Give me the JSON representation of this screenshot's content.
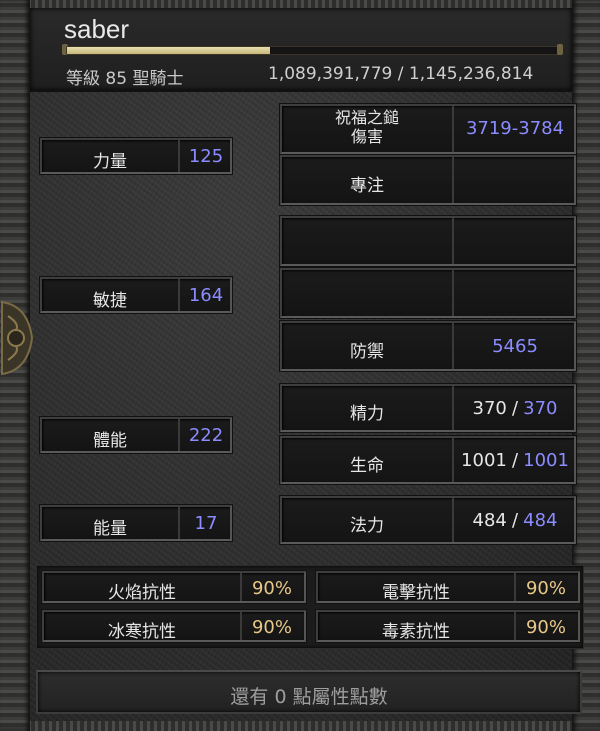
{
  "character": {
    "name": "saber",
    "level_class": "等級 85 聖騎士",
    "xp_text": "1,089,391,779 / 1,145,236,814",
    "xp_bar_fraction": 0.41
  },
  "attributes": [
    {
      "label": "力量",
      "value": "125"
    },
    {
      "label": "敏捷",
      "value": "164"
    },
    {
      "label": "體能",
      "value": "222"
    },
    {
      "label": "能量",
      "value": "17"
    }
  ],
  "stats": {
    "skill": {
      "label_line1": "祝福之鎚",
      "label_line2": "傷害",
      "value": "3719-3784"
    },
    "focus": {
      "label": "專注",
      "value": ""
    },
    "defense": {
      "label": "防禦",
      "value": "5465"
    },
    "stamina": {
      "label": "精力",
      "current": "370",
      "sep": "/",
      "max": "370"
    },
    "life": {
      "label": "生命",
      "current": "1001",
      "sep": "/",
      "max": "1001"
    },
    "mana": {
      "label": "法力",
      "current": "484",
      "sep": "/",
      "max": "484"
    }
  },
  "resistances": [
    {
      "label": "火焰抗性",
      "value": "90%"
    },
    {
      "label": "電擊抗性",
      "value": "90%"
    },
    {
      "label": "冰寒抗性",
      "value": "90%"
    },
    {
      "label": "毒素抗性",
      "value": "90%"
    }
  ],
  "footer": {
    "points_text": "還有 0 點屬性點數"
  },
  "colors": {
    "blue_value": "#8a8cff",
    "gold_value": "#e7c888",
    "xp_fill": "#e8dfb0"
  }
}
